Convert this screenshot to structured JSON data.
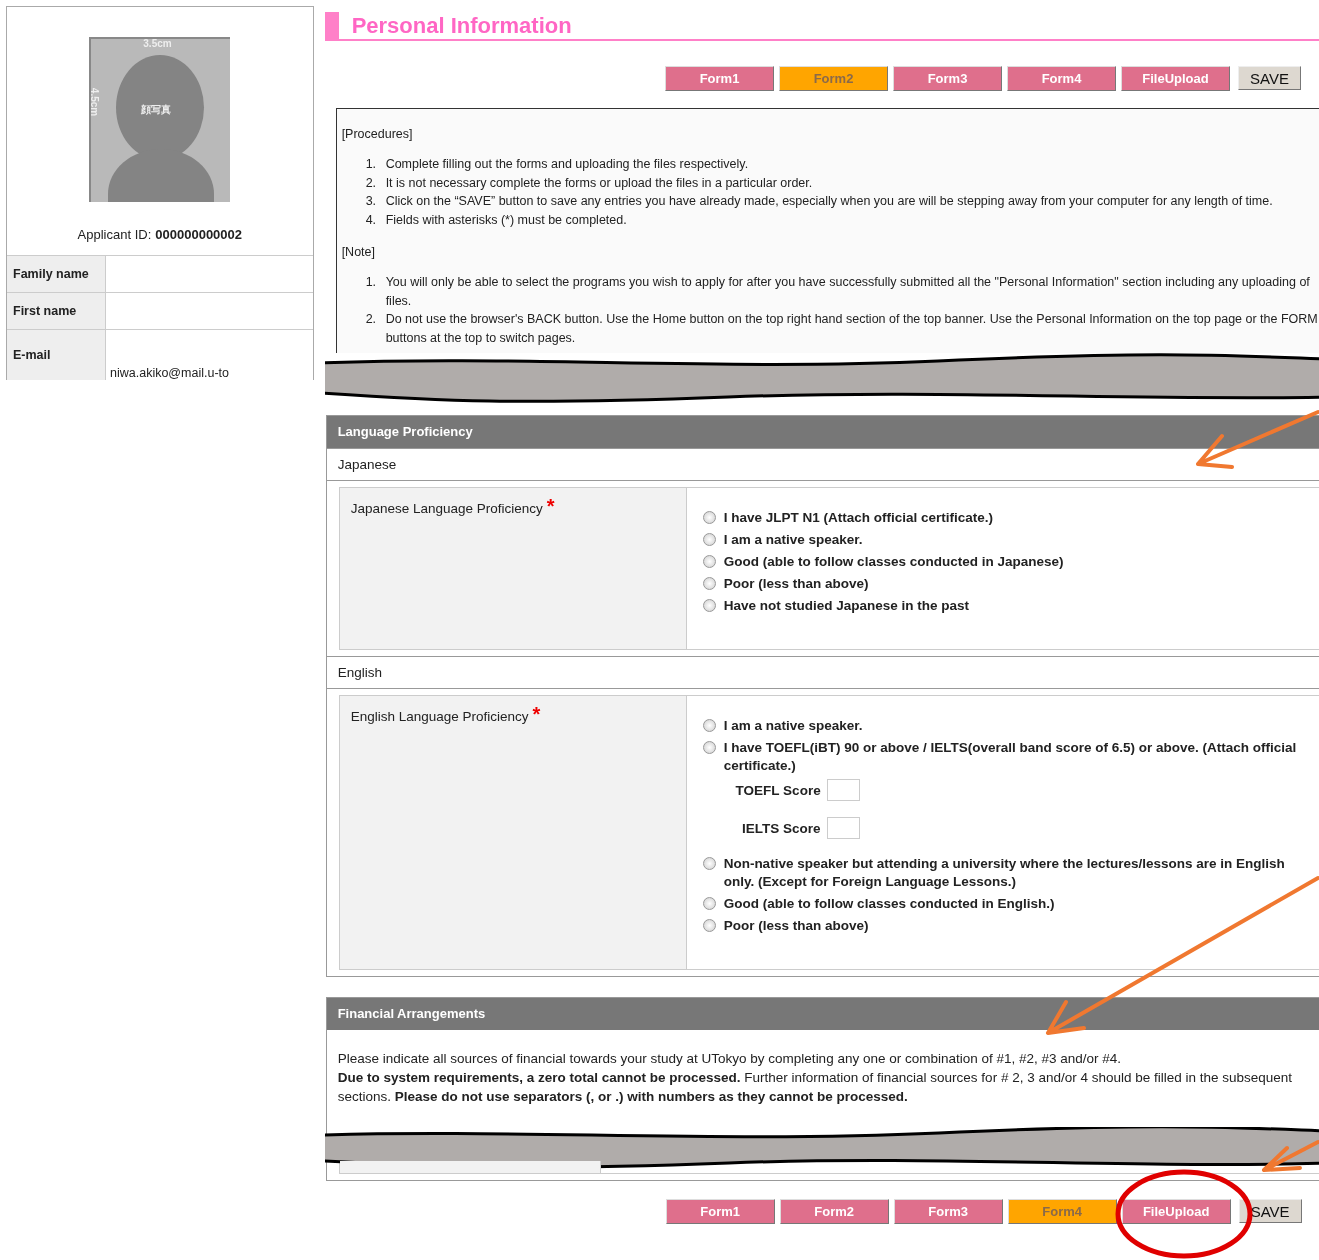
{
  "photo": {
    "width_label": "3.5cm",
    "height_label": "4.5cm",
    "caption": "顔写真"
  },
  "applicant": {
    "label": "Applicant ID:",
    "value": "000000000002"
  },
  "profile_fields": [
    {
      "label": "Family name"
    },
    {
      "label": "First name"
    },
    {
      "label": "E-mail",
      "value": "niwa.akiko@mail.u-to"
    }
  ],
  "page_title": "Personal Information",
  "nav_top": {
    "tabs": [
      {
        "label": "Form1",
        "selected": false
      },
      {
        "label": "Form2",
        "selected": true
      },
      {
        "label": "Form3",
        "selected": false
      },
      {
        "label": "Form4",
        "selected": false
      },
      {
        "label": "FileUpload",
        "selected": false
      }
    ],
    "save": "SAVE"
  },
  "instructions": {
    "procedures_heading": "[Procedures]",
    "procedures": [
      {
        "number": "1.",
        "text": "Complete filling out the forms and uploading the files respectively."
      },
      {
        "number": "2.",
        "text": "It is not necessary complete the forms or upload the files in a particular order."
      },
      {
        "number": "3.",
        "text": "Click on the “SAVE” button to save any entries you have already made, especially when you are will be stepping away from your computer for any length of time."
      },
      {
        "number": "4.",
        "text": "Fields with asterisks (*) must be completed."
      }
    ],
    "note_heading": "[Note]",
    "notes": [
      {
        "number": "1.",
        "text": "You will only be able to select the programs you wish to apply for after you have successfully submitted all the \"Personal Information\" section including any uploading of files."
      },
      {
        "number": "2.",
        "text": "Do not use the browser's BACK button. Use the Home button on the top right hand section of the top banner. Use the Personal Information on the top page or the FORM buttons at the top to switch pages."
      }
    ]
  },
  "language": {
    "title": "Language Proficiency",
    "groups": [
      {
        "name": "Japanese",
        "question": "Japanese Language Proficiency",
        "required_mark": "*",
        "options": [
          {
            "kind": "radio",
            "label": "I have JLPT N1 (Attach official certificate.)",
            "selected": false
          },
          {
            "kind": "radio",
            "label": "I am a native speaker.",
            "selected": false
          },
          {
            "kind": "radio",
            "label": "Good (able to follow classes conducted in Japanese)",
            "selected": false
          },
          {
            "kind": "radio",
            "label": "Poor (less than above)",
            "selected": false
          },
          {
            "kind": "radio",
            "label": "Have not studied Japanese in the past",
            "selected": false
          }
        ]
      },
      {
        "name": "English",
        "question": "English Language Proficiency",
        "required_mark": "*",
        "options": [
          {
            "kind": "radio",
            "label": "I am a native speaker.",
            "selected": false
          },
          {
            "kind": "radio",
            "label": "I have TOEFL(iBT) 90 or above / IELTS(overall band score of 6.5) or above. (Attach official certificate.)",
            "selected": false
          },
          {
            "kind": "score",
            "label": "TOEFL Score"
          },
          {
            "kind": "score",
            "label": "IELTS Score"
          },
          {
            "kind": "radio",
            "label": "Non-native speaker but attending a university where the lectures/lessons are in English only. (Except for Foreign Language Lessons.)",
            "selected": false
          },
          {
            "kind": "radio",
            "label": "Good (able to follow classes conducted in English.)",
            "selected": false
          },
          {
            "kind": "radio",
            "label": "Poor (less than above)",
            "selected": false
          }
        ]
      }
    ]
  },
  "financial": {
    "title": "Financial Arrangements",
    "intro": "Please indicate all sources of financial towards your study at UTokyo by completing any one or combination of #1, #2, #3 and/or #4.",
    "note": "**Due to system requirements, a zero total cannot be processed.** Further information of financial sources for # 2, 3 and/or 4 should be filled in the subsequent sections. **Please do not use separators (, or .) with numbers as they cannot be processed.**"
  },
  "nav_bottom": {
    "tabs": [
      {
        "label": "Form1",
        "selected": false
      },
      {
        "label": "Form2",
        "selected": false
      },
      {
        "label": "Form3",
        "selected": false
      },
      {
        "label": "Form4",
        "selected": true
      },
      {
        "label": "FileUpload",
        "selected": false
      }
    ],
    "save": "SAVE"
  }
}
